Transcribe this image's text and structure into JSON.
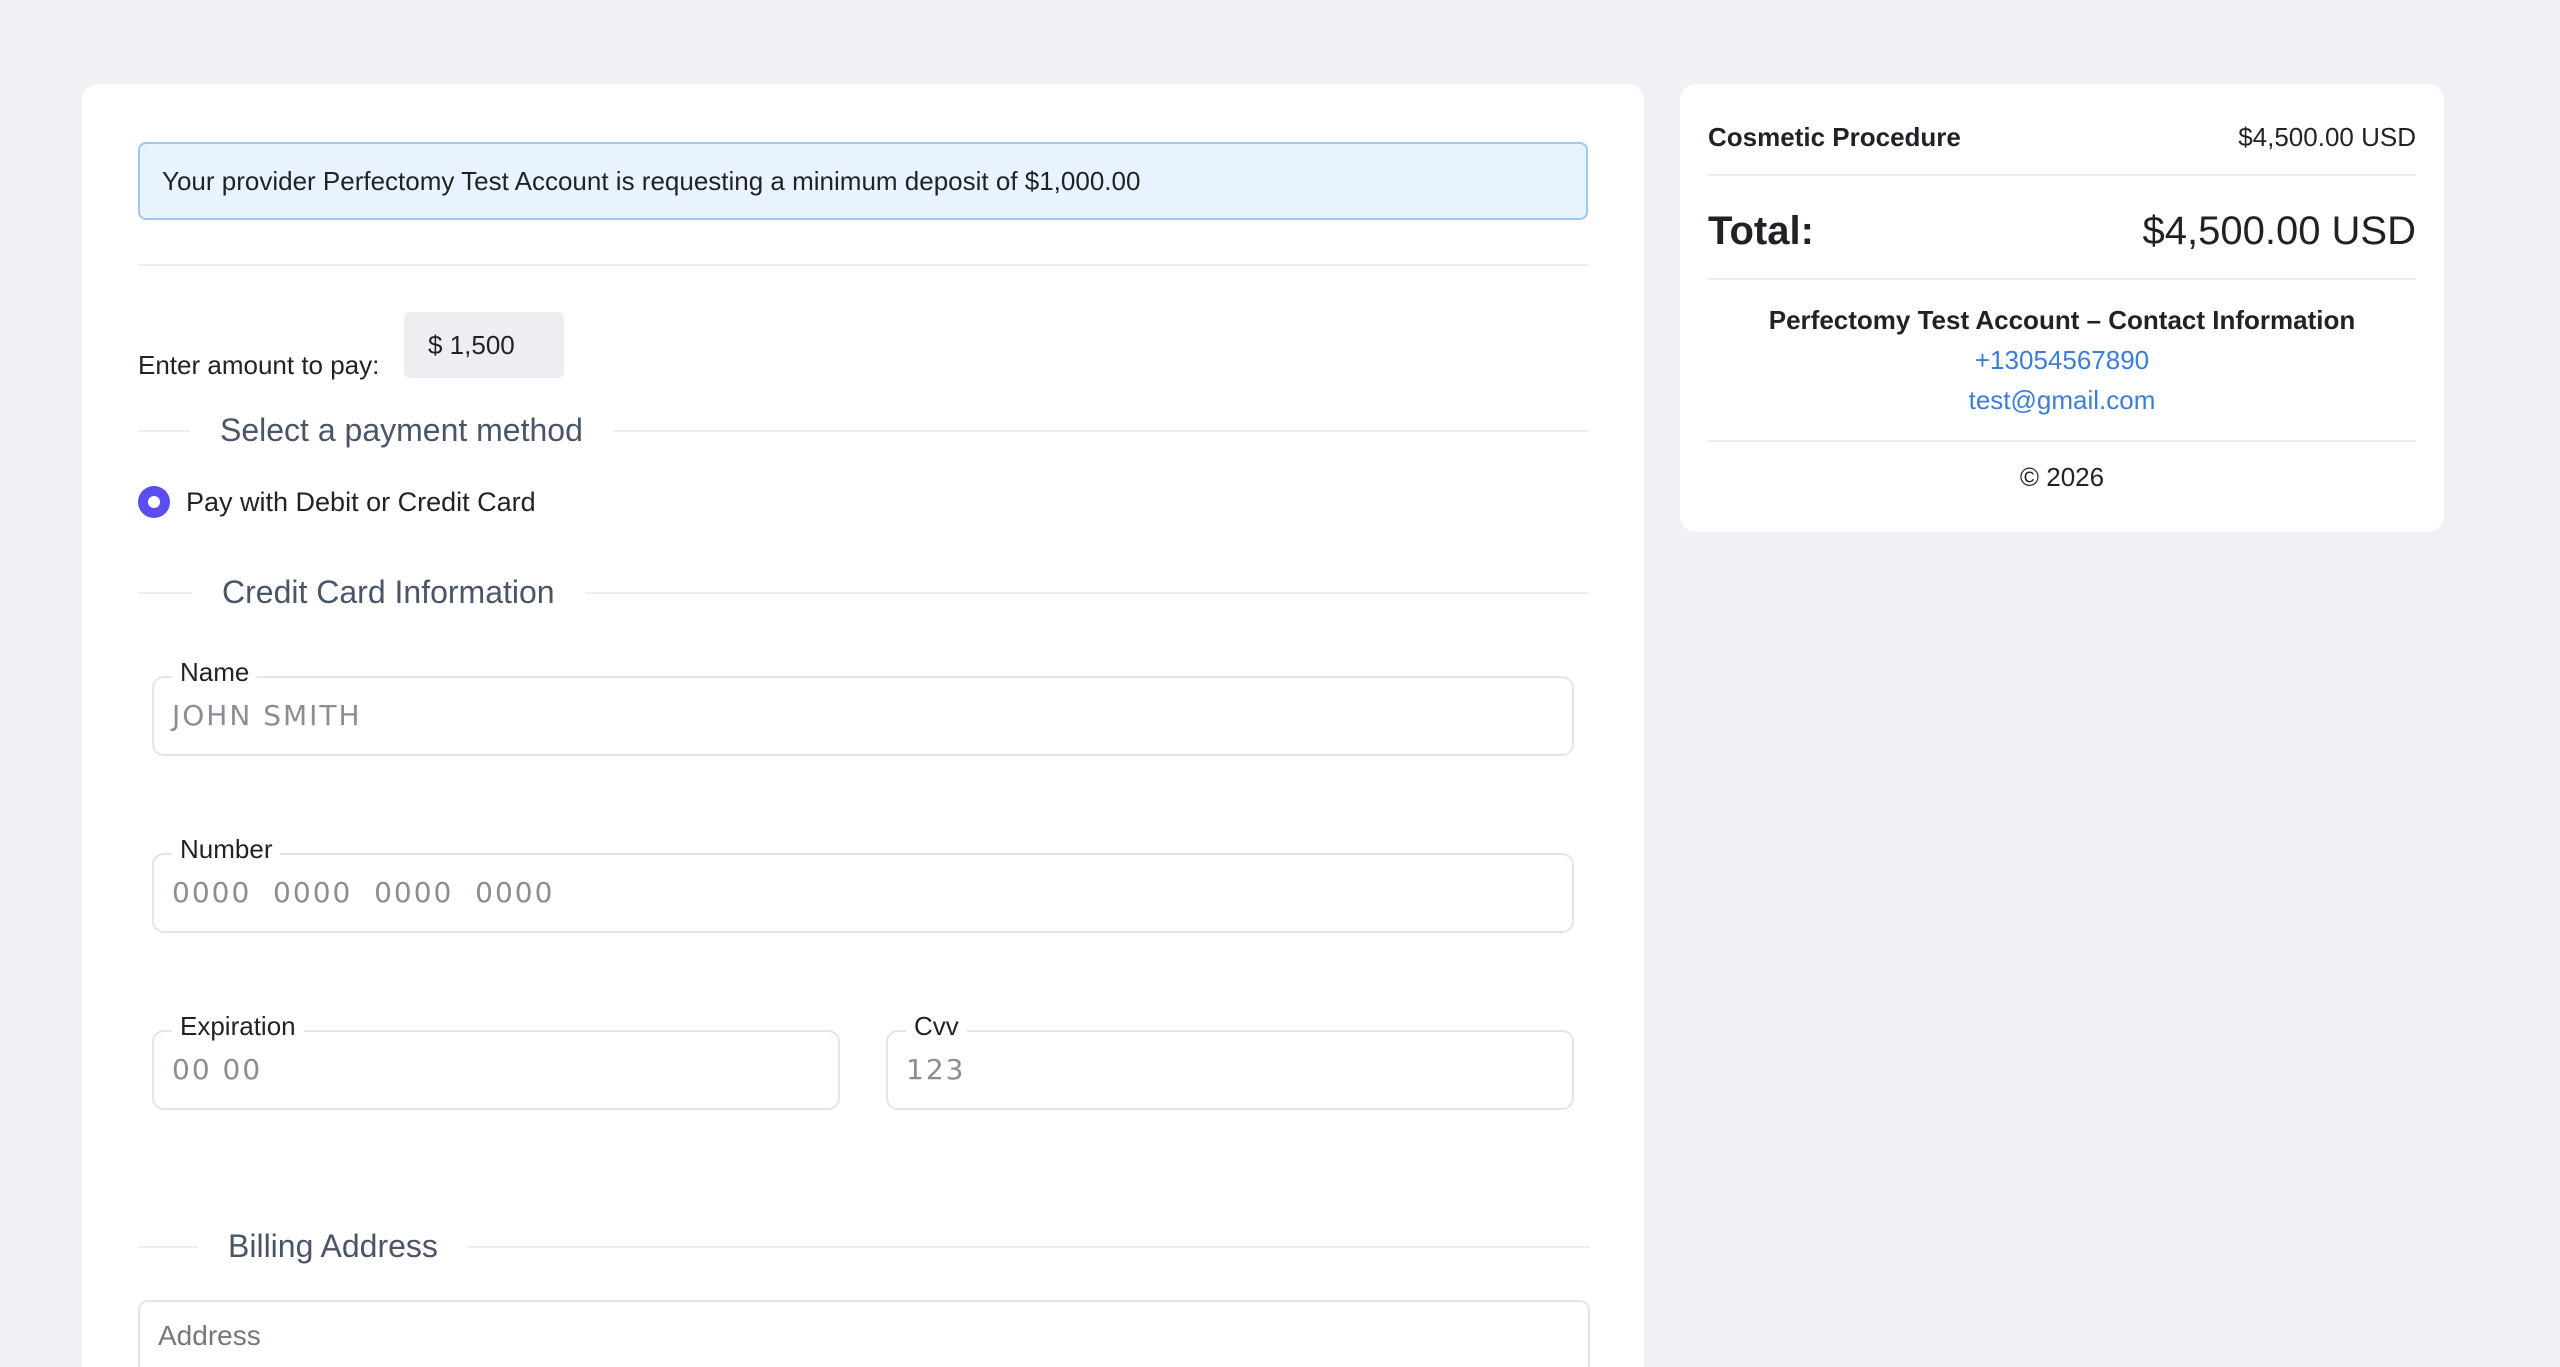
{
  "notice": {
    "text": "Your provider Perfectomy Test Account is requesting a minimum deposit of $1,000.00"
  },
  "amount": {
    "label": "Enter amount to pay:",
    "value": "$ 1,500"
  },
  "payment_method": {
    "section_title": "Select a payment method",
    "option_label": "Pay with Debit or Credit Card",
    "selected": true
  },
  "credit_card": {
    "section_title": "Credit Card Information",
    "name_label": "Name",
    "name_placeholder": "JOHN SMITH",
    "number_label": "Number",
    "number_placeholder": "0000  0000  0000  0000",
    "expiration_label": "Expiration",
    "expiration_placeholder": "00 00",
    "cvv_label": "Cvv",
    "cvv_placeholder": "123"
  },
  "billing": {
    "section_title": "Billing Address",
    "address_placeholder": "Address"
  },
  "summary": {
    "item_name": "Cosmetic Procedure",
    "item_price": "$4,500.00 USD",
    "total_label": "Total:",
    "total_value": "$4,500.00 USD",
    "contact_title": "Perfectomy Test Account – Contact Information",
    "phone": "+13054567890",
    "email": "test@gmail.com",
    "copyright": "© 2026"
  },
  "colors": {
    "accent": "#5b4ef0",
    "link": "#3b7ddd",
    "notice_bg": "#e8f3fd",
    "notice_border": "#9cc9ef"
  }
}
